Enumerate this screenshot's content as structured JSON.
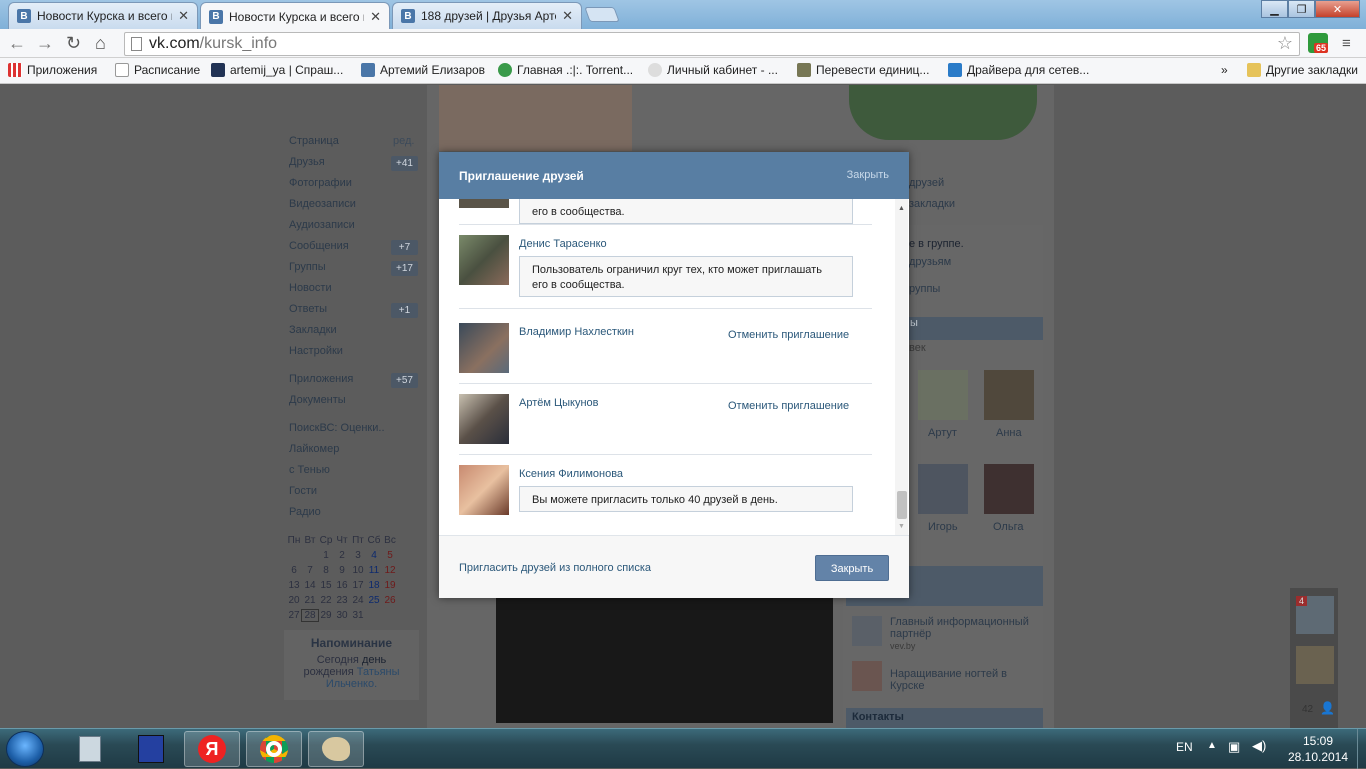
{
  "browser": {
    "tabs": [
      {
        "title": "Новости Курска и всего г",
        "icon": "vk-icon"
      },
      {
        "title": "Новости Курска и всего г",
        "icon": "vk-icon"
      },
      {
        "title": "188 друзей | Друзья Арте",
        "icon": "vk-icon"
      }
    ],
    "url_domain": "vk.com",
    "url_path": "/kursk_info",
    "extension_badge": "65",
    "bookmarks": [
      "Приложения",
      "Расписание",
      "artemij_ya | Спраш...",
      "Артемий Елизаров",
      "Главная .:|:. Torrent...",
      "Личный кабинет - ...",
      "Перевести единиц...",
      "Драйвера для сетев...",
      "»",
      "Другие закладки"
    ]
  },
  "page": {
    "left_menu": [
      {
        "label": "Страница",
        "extra": "ред."
      },
      {
        "label": "Друзья",
        "count": "+41"
      },
      {
        "label": "Фотографии"
      },
      {
        "label": "Видеозаписи"
      },
      {
        "label": "Аудиозаписи"
      },
      {
        "label": "Сообщения",
        "count": "+7"
      },
      {
        "label": "Группы",
        "count": "+17"
      },
      {
        "label": "Новости"
      },
      {
        "label": "Ответы",
        "count": "+1"
      },
      {
        "label": "Закладки"
      },
      {
        "label": "Настройки"
      },
      {
        "label": "Приложения",
        "count": "+57"
      },
      {
        "label": "Документы"
      },
      {
        "label": "ПоискВС: Оценки.."
      },
      {
        "label": "Лайкомер"
      },
      {
        "label": "с Тенью"
      },
      {
        "label": "Гости"
      },
      {
        "label": "Радио"
      }
    ],
    "calendar": {
      "weekdays": [
        "Пн",
        "Вт",
        "Ср",
        "Чт",
        "Пт",
        "Сб",
        "Вс"
      ],
      "rows": [
        [
          "",
          "",
          "1",
          "2",
          "3",
          "4",
          "5"
        ],
        [
          "6",
          "7",
          "8",
          "9",
          "10",
          "11",
          "12"
        ],
        [
          "13",
          "14",
          "15",
          "16",
          "17",
          "18",
          "19"
        ],
        [
          "20",
          "21",
          "22",
          "23",
          "24",
          "25",
          "26"
        ],
        [
          "27",
          "28",
          "29",
          "30",
          "31",
          "",
          ""
        ]
      ]
    },
    "reminder": {
      "title": "Напоминание",
      "text_1": "Сегодня",
      "text_2": "день",
      "text_3": "рождения",
      "name_1": "Татьяны",
      "name_2": "Ильченко."
    },
    "right_fragments": {
      "r1": "друзей",
      "r2": "закладки",
      "r3": "е в группе.",
      "r4": "друзьям",
      "r5": "руппы",
      "r6": "ы",
      "r7": "век",
      "friend_1": "Артут",
      "friend_2": "Анна",
      "friend_3": "Игорь",
      "friend_4": "Ольга",
      "group_1_title": "Главный информационный партнёр",
      "group_1_sub": "vev.by",
      "group_2_title": "Наращивание ногтей в Курске",
      "contacts": "Контакты",
      "chat_badge": "4",
      "chat_count": "42"
    }
  },
  "modal": {
    "title": "Приглашение друзей",
    "close_link": "Закрыть",
    "partial_msg_line2": "его в сообщества.",
    "friends": [
      {
        "name": "Денис Тарасенко",
        "message_line1": "Пользователь ограничил круг тех, кто может приглашать",
        "message_line2": "его в сообщества."
      },
      {
        "name": "Владимир Нахлесткин",
        "action": "Отменить приглашение"
      },
      {
        "name": "Артём Цыкунов",
        "action": "Отменить приглашение"
      },
      {
        "name": "Ксения Филимонова",
        "message_line1": "Вы можете пригласить только 40 друзей в день."
      }
    ],
    "footer_link": "Пригласить друзей из полного списка",
    "footer_button": "Закрыть"
  },
  "taskbar": {
    "lang": "EN",
    "time": "15:09",
    "date": "28.10.2014"
  }
}
